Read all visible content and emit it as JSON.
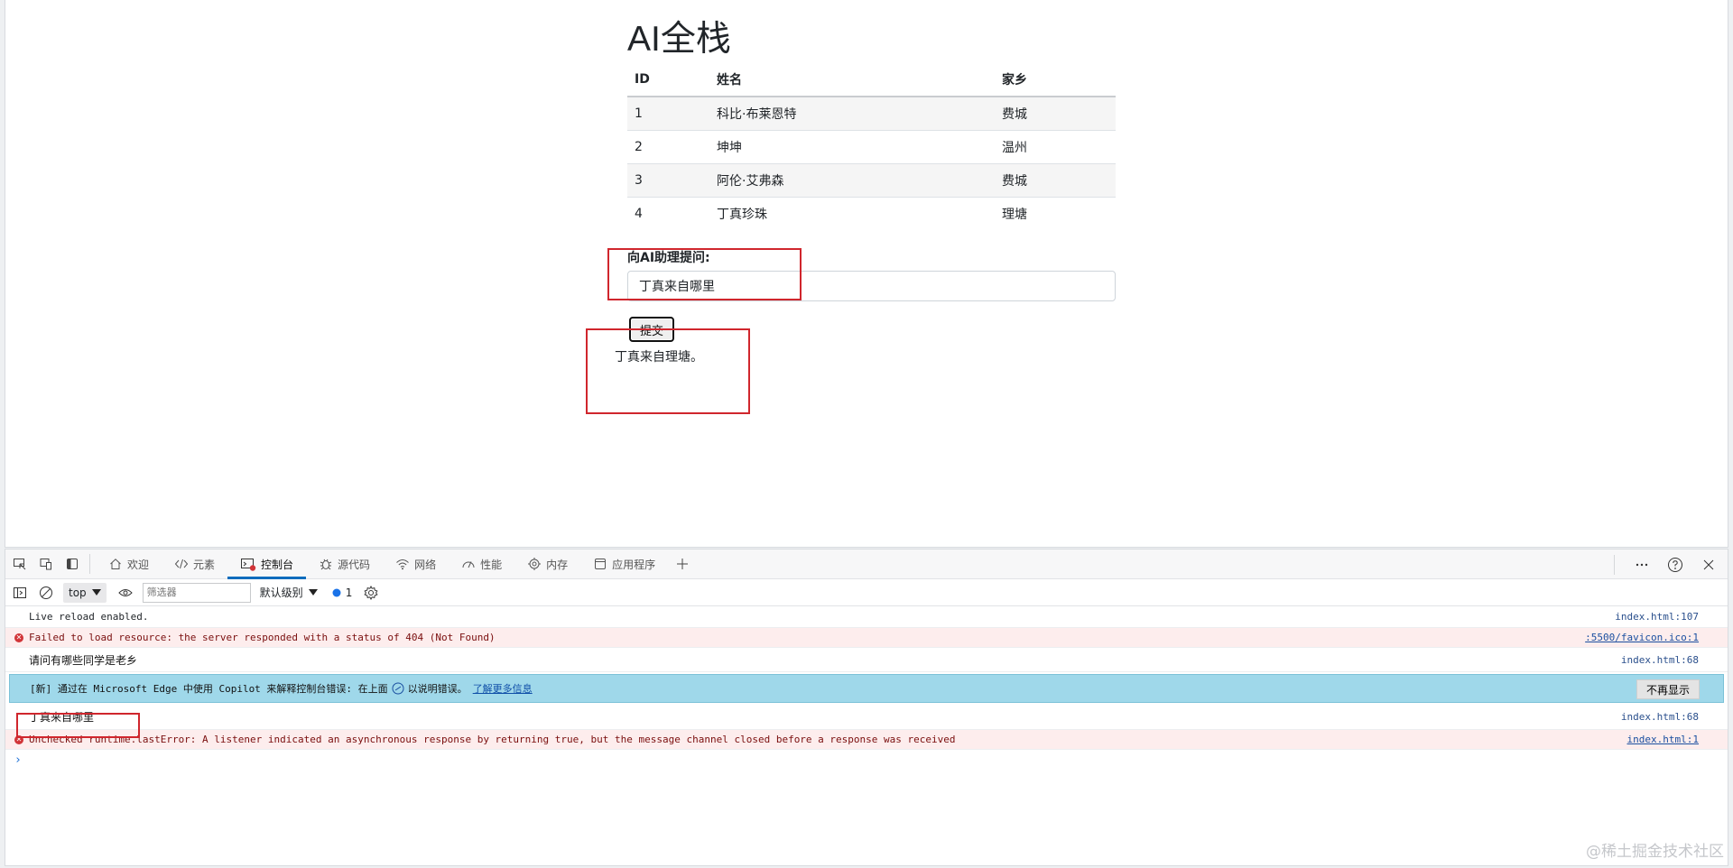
{
  "page": {
    "title": "AI全栈",
    "table": {
      "headers": [
        "ID",
        "姓名",
        "家乡"
      ],
      "rows": [
        [
          "1",
          "科比·布莱恩特",
          "费城"
        ],
        [
          "2",
          "坤坤",
          "温州"
        ],
        [
          "3",
          "阿伦·艾弗森",
          "费城"
        ],
        [
          "4",
          "丁真珍珠",
          "理塘"
        ]
      ]
    },
    "ask_label": "向AI助理提问:",
    "ask_value": "丁真来自哪里",
    "submit_label": "提交",
    "answer": "丁真来自理塘。"
  },
  "devtools": {
    "tabs": [
      {
        "label": "欢迎",
        "icon": "home-icon"
      },
      {
        "label": "元素",
        "icon": "code-icon"
      },
      {
        "label": "控制台",
        "icon": "console-icon",
        "active": true
      },
      {
        "label": "源代码",
        "icon": "bug-icon"
      },
      {
        "label": "网络",
        "icon": "wifi-icon"
      },
      {
        "label": "性能",
        "icon": "gauge-icon"
      },
      {
        "label": "内存",
        "icon": "chip-icon"
      },
      {
        "label": "应用程序",
        "icon": "window-icon"
      }
    ],
    "toolbar": {
      "context": "top",
      "filter_placeholder": "筛选器",
      "level": "默认级别",
      "issues_count": "1"
    },
    "console": {
      "rows": [
        {
          "text": "Live reload enabled.",
          "source": "index.html:107",
          "type": "log"
        },
        {
          "text": "Failed to load resource: the server responded with a status of 404 (Not Found)",
          "source": ":5500/favicon.ico:1",
          "type": "error"
        },
        {
          "text": "请问有哪些同学是老乡",
          "source": "index.html:68",
          "type": "log"
        },
        {
          "text": "丁真来自哪里",
          "source": "index.html:68",
          "type": "log"
        },
        {
          "text": "Unchecked runtime.lastError: A listener indicated an asynchronous response by returning true, but the message channel closed before a response was received",
          "source": "index.html:1",
          "type": "error"
        }
      ],
      "copilot_banner": "[新] 通过在 Microsoft Edge 中使用 Copilot 来解释控制台错误: 在上面",
      "copilot_banner_tail": "以说明错误。",
      "copilot_link": "了解更多信息",
      "dismiss_label": "不再显示",
      "prompt_symbol": "›"
    }
  },
  "watermark": "@稀土掘金技术社区",
  "colors": {
    "highlight_box": "#d0262d",
    "active_tab": "#0f6cbd",
    "error_bg": "#fdeded",
    "banner_bg": "#9fd8ea"
  }
}
